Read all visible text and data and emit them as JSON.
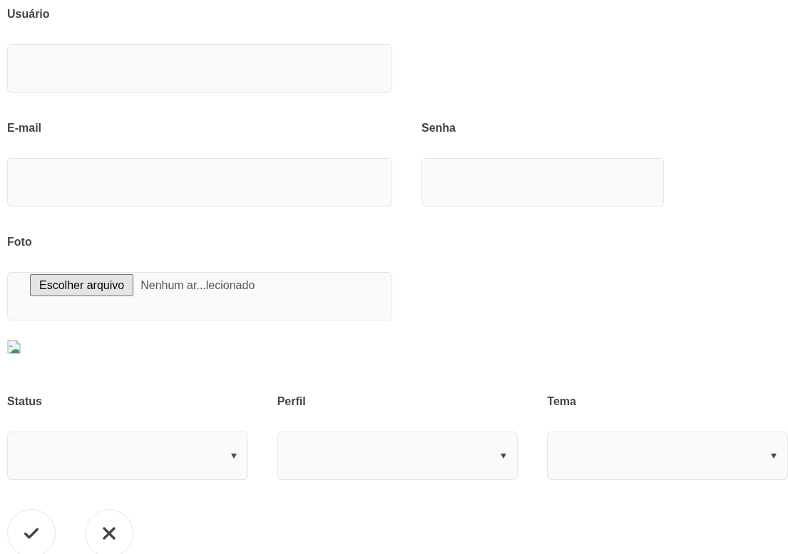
{
  "rows": [
    {
      "fields": [
        {
          "kind": "text",
          "label": "Usuário"
        }
      ]
    },
    {
      "fields": [
        {
          "kind": "text",
          "label": "E-mail"
        },
        {
          "kind": "password",
          "label": "Senha"
        }
      ]
    },
    {
      "fields": [
        {
          "kind": "file",
          "label": "Foto",
          "button_label": "Escolher arquivo",
          "status_text": "Nenhum ar...lecionado"
        }
      ]
    },
    {
      "fields": [
        {
          "kind": "image"
        }
      ]
    },
    {
      "fields": [
        {
          "kind": "select",
          "label": "Status"
        },
        {
          "kind": "select",
          "label": "Perfil"
        },
        {
          "kind": "select",
          "label": "Tema"
        }
      ]
    }
  ],
  "buttons": [
    {
      "kind": "confirm"
    },
    {
      "kind": "cancel"
    }
  ]
}
